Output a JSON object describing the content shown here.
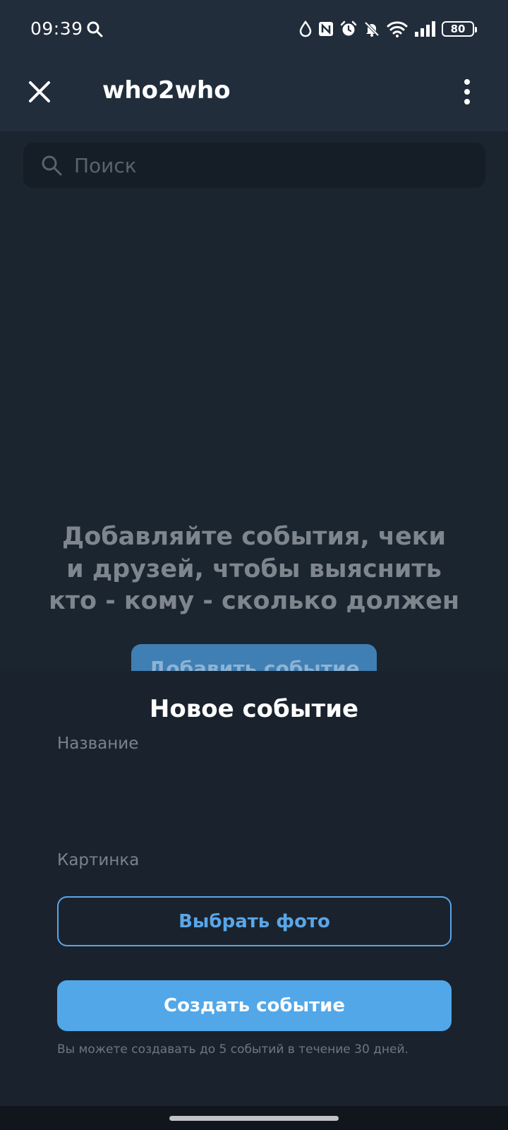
{
  "status_bar": {
    "time": "09:39",
    "battery": "80",
    "icons": [
      "search-icon",
      "drop-icon",
      "nfc-icon",
      "alarm-icon",
      "mute-icon",
      "wifi-icon",
      "signal-icon",
      "battery-icon"
    ]
  },
  "app_bar": {
    "title": "who2who",
    "close_icon": "close-icon",
    "menu_icon": "more-vert-icon"
  },
  "search": {
    "placeholder": "Поиск"
  },
  "empty_state": {
    "line1": "Добавляйте события, чеки",
    "line2": "и друзей, чтобы выяснить",
    "line3": "кто - кому - сколько должен",
    "add_button": "Добавить событие"
  },
  "sheet": {
    "title": "Новое событие",
    "name_label": "Название",
    "name_value": "",
    "image_label": "Картинка",
    "choose_photo": "Выбрать фото",
    "create_button": "Создать событие",
    "note": "Вы можете создавать до 5 событий в течение 30 дней."
  },
  "colors": {
    "accent": "#52a7e8",
    "background": "#1b2530",
    "sheet": "#1a232d"
  }
}
